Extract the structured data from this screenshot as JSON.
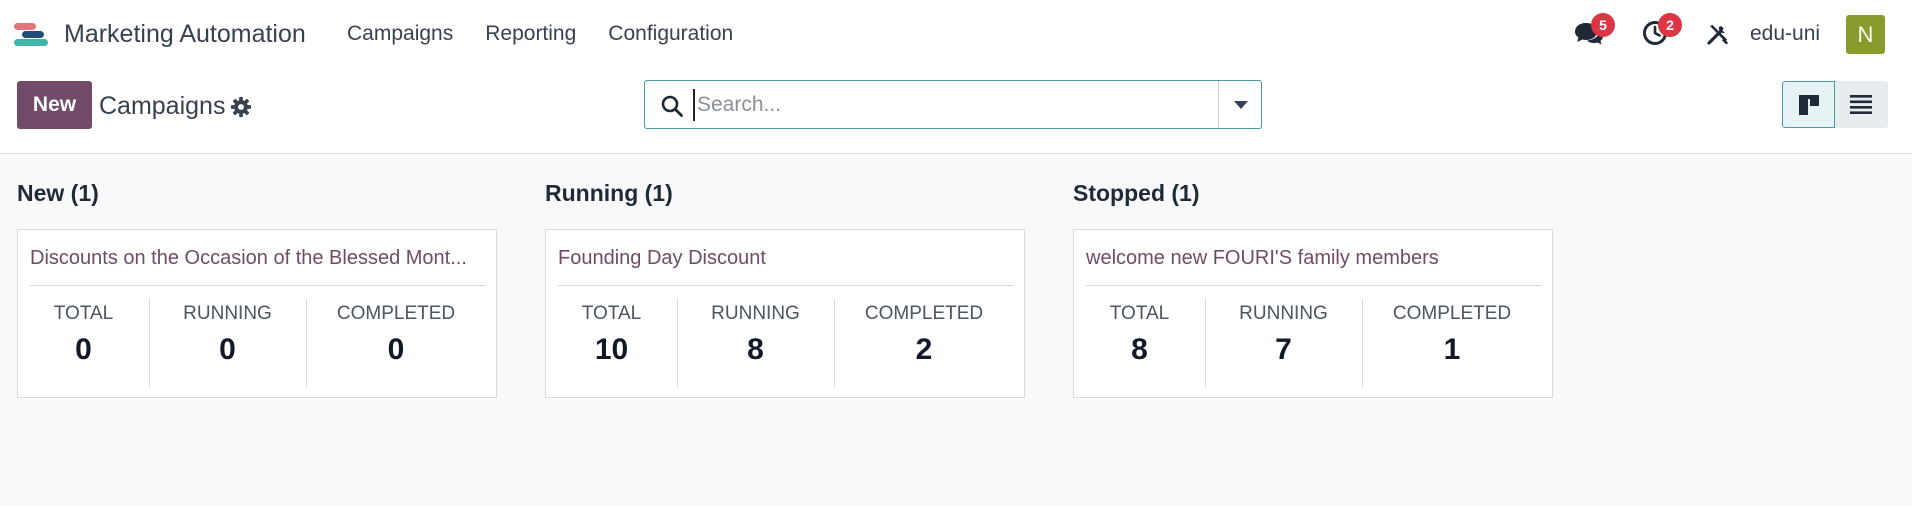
{
  "navbar": {
    "app_title": "Marketing Automation",
    "menu": [
      "Campaigns",
      "Reporting",
      "Configuration"
    ],
    "messages_badge": "5",
    "activities_badge": "2",
    "user_name": "edu-uni",
    "avatar_letter": "N",
    "avatar_color": "#8a9b2e"
  },
  "control": {
    "new_label": "New",
    "page_title": "Campaigns",
    "search_placeholder": "Search...",
    "accent": "#714b67"
  },
  "columns": [
    {
      "title": "New (1)",
      "card": {
        "name": "Discounts on the Occasion of the Blessed Mont...",
        "total_label": "TOTAL",
        "total": "0",
        "running_label": "RUNNING",
        "running": "0",
        "completed_label": "COMPLETED",
        "completed": "0"
      }
    },
    {
      "title": "Running (1)",
      "card": {
        "name": "Founding Day Discount",
        "total_label": "TOTAL",
        "total": "10",
        "running_label": "RUNNING",
        "running": "8",
        "completed_label": "COMPLETED",
        "completed": "2"
      }
    },
    {
      "title": "Stopped (1)",
      "card": {
        "name": "welcome new FOURI'S family members",
        "total_label": "TOTAL",
        "total": "8",
        "running_label": "RUNNING",
        "running": "7",
        "completed_label": "COMPLETED",
        "completed": "1"
      }
    }
  ]
}
